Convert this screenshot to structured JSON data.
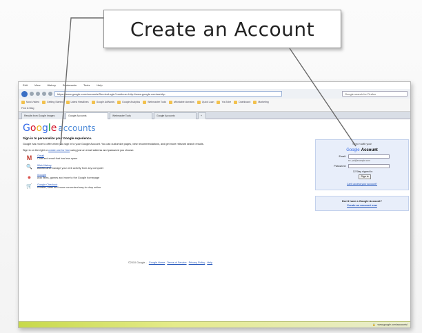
{
  "callout": {
    "text": "Create an Account"
  },
  "browser": {
    "menus": [
      "Edit",
      "View",
      "History",
      "Bookmarks",
      "Tools",
      "Help"
    ],
    "url": "https://www.google.com/accounts/ServiceLogin?continue=http://www.google.com/webhp",
    "search_placeholder": "Google search for Firefox",
    "bookmarks": [
      "Most Visited",
      "Getting Started",
      "Latest Headlines",
      "Google AdWords",
      "Google Analytics",
      "Webmaster Tools",
      "affordable domains",
      "Quick Loan",
      "YouTube",
      "Dashboard",
      "Marketing"
    ],
    "toolbar2_text": "Find in Blog",
    "tabs": [
      "Results from Google Images",
      "Google Accounts",
      "Webmaster Tools",
      "Google Accounts",
      "+"
    ]
  },
  "page": {
    "logo_google": [
      "G",
      "o",
      "o",
      "g",
      "l",
      "e"
    ],
    "logo_accounts": "accounts",
    "headline": "Sign in to personalize your Google experience.",
    "intro": "Google has more to offer when you sign in to your Google Account. You can customize pages, view recommendations, and get more relevant search results.",
    "intro2_prefix": "Sign in on the right or",
    "intro2_link": "create one for free",
    "intro2_suffix": "using just an email address and password you choose.",
    "services": [
      {
        "icon": "gmail-icon",
        "glyph": "M",
        "color": "#c0392b",
        "title": "Gmail",
        "desc": "Chat and email that has less spam"
      },
      {
        "icon": "web-history-icon",
        "glyph": "🔍",
        "color": "#555",
        "title": "Web History",
        "desc": "Access and manage your web activity from any computer"
      },
      {
        "icon": "igoogle-icon",
        "glyph": "●",
        "color": "#d9534f",
        "title": "iGoogle",
        "desc": "Add news, games and more to the Google homepage"
      },
      {
        "icon": "google-checkout-icon",
        "glyph": "🛒",
        "color": "#2d6cb5",
        "title": "Google Checkout",
        "desc": "A faster, safer and more convenient way to shop online"
      }
    ],
    "footer_copyright": "©2010 Google -",
    "footer_links": [
      "Google Home",
      "Terms of Service",
      "Privacy Policy",
      "Help"
    ]
  },
  "signin": {
    "heading": "Sign in with your",
    "brand": "Google",
    "account": "Account",
    "email_label": "Email:",
    "email_hint": "ex: pat@example.com",
    "password_label": "Password:",
    "stay_signed_in": "Stay signed in",
    "sign_in_button": "Sign in",
    "cant_access": "Can't access your account?"
  },
  "create": {
    "question": "Don't have a Google Account?",
    "link": "Create an account now"
  },
  "status": {
    "text": "www.google.com/accounts/"
  }
}
